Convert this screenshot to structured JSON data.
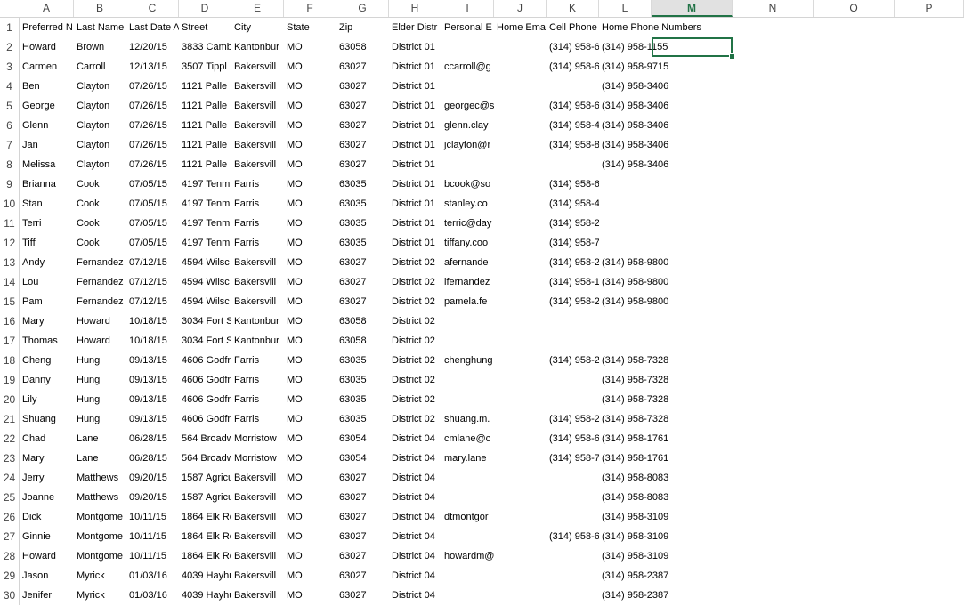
{
  "sheet": {
    "columns": [
      "A",
      "B",
      "C",
      "D",
      "E",
      "F",
      "G",
      "H",
      "I",
      "J",
      "K",
      "L",
      "M",
      "N",
      "O",
      "P"
    ],
    "active_column": "M",
    "row_numbers": [
      "1",
      "2",
      "3",
      "4",
      "5",
      "6",
      "7",
      "8",
      "9",
      "10",
      "11",
      "12",
      "13",
      "14",
      "15",
      "16",
      "17",
      "18",
      "19",
      "20",
      "21",
      "22",
      "23",
      "24",
      "25",
      "26",
      "27",
      "28",
      "29",
      "30"
    ],
    "headers": [
      "Preferred N",
      "Last Name",
      "Last Date A",
      "Street",
      "City",
      "State",
      "Zip",
      "Elder Distr",
      "Personal E",
      "Home Ema",
      "Cell Phone",
      "Home Phone Numbers"
    ],
    "rows": [
      [
        "Howard",
        "Brown",
        "12/20/15",
        "3833 Camb",
        "Kantonbur",
        "MO",
        "63058",
        "District 01",
        "",
        "",
        "(314) 958-6",
        "(314) 958-1155"
      ],
      [
        "Carmen",
        "Carroll",
        "12/13/15",
        "3507 Tippl",
        "Bakersvill",
        "MO",
        "63027",
        "District 01",
        "ccarroll@g",
        "",
        "(314) 958-6",
        "(314) 958-9715"
      ],
      [
        "Ben",
        "Clayton",
        "07/26/15",
        "1121 Palle",
        "Bakersvill",
        "MO",
        "63027",
        "District 01",
        "",
        "",
        "",
        "(314) 958-3406"
      ],
      [
        "George",
        "Clayton",
        "07/26/15",
        "1121 Palle",
        "Bakersvill",
        "MO",
        "63027",
        "District 01",
        "georgec@s",
        "",
        "(314) 958-6",
        "(314) 958-3406"
      ],
      [
        "Glenn",
        "Clayton",
        "07/26/15",
        "1121 Palle",
        "Bakersvill",
        "MO",
        "63027",
        "District 01",
        "glenn.clay",
        "",
        "(314) 958-4",
        "(314) 958-3406"
      ],
      [
        "Jan",
        "Clayton",
        "07/26/15",
        "1121 Palle",
        "Bakersvill",
        "MO",
        "63027",
        "District 01",
        "jclayton@r",
        "",
        "(314) 958-8",
        "(314) 958-3406"
      ],
      [
        "Melissa",
        "Clayton",
        "07/26/15",
        "1121 Palle",
        "Bakersvill",
        "MO",
        "63027",
        "District 01",
        "",
        "",
        "",
        "(314) 958-3406"
      ],
      [
        "Brianna",
        "Cook",
        "07/05/15",
        "4197 Tenm",
        "Farris",
        "MO",
        "63035",
        "District 01",
        "bcook@so",
        "",
        "(314) 958-6",
        ""
      ],
      [
        "Stan",
        "Cook",
        "07/05/15",
        "4197 Tenm",
        "Farris",
        "MO",
        "63035",
        "District 01",
        "stanley.co",
        "",
        "(314) 958-4",
        ""
      ],
      [
        "Terri",
        "Cook",
        "07/05/15",
        "4197 Tenm",
        "Farris",
        "MO",
        "63035",
        "District 01",
        "terric@day",
        "",
        "(314) 958-2",
        ""
      ],
      [
        "Tiff",
        "Cook",
        "07/05/15",
        "4197 Tenm",
        "Farris",
        "MO",
        "63035",
        "District 01",
        "tiffany.coo",
        "",
        "(314) 958-7",
        ""
      ],
      [
        "Andy",
        "Fernandez",
        "07/12/15",
        "4594 Wilsc",
        "Bakersvill",
        "MO",
        "63027",
        "District 02",
        "afernande",
        "",
        "(314) 958-2",
        "(314) 958-9800"
      ],
      [
        "Lou",
        "Fernandez",
        "07/12/15",
        "4594 Wilsc",
        "Bakersvill",
        "MO",
        "63027",
        "District 02",
        "lfernandez",
        "",
        "(314) 958-1",
        "(314) 958-9800"
      ],
      [
        "Pam",
        "Fernandez",
        "07/12/15",
        "4594 Wilsc",
        "Bakersvill",
        "MO",
        "63027",
        "District 02",
        "pamela.fe",
        "",
        "(314) 958-2",
        "(314) 958-9800"
      ],
      [
        "Mary",
        "Howard",
        "10/18/15",
        "3034 Fort S",
        "Kantonbur",
        "MO",
        "63058",
        "District 02",
        "",
        "",
        "",
        ""
      ],
      [
        "Thomas",
        "Howard",
        "10/18/15",
        "3034 Fort S",
        "Kantonbur",
        "MO",
        "63058",
        "District 02",
        "",
        "",
        "",
        ""
      ],
      [
        "Cheng",
        "Hung",
        "09/13/15",
        "4606 Godfr",
        "Farris",
        "MO",
        "63035",
        "District 02",
        "chenghung",
        "",
        "(314) 958-2",
        "(314) 958-7328"
      ],
      [
        "Danny",
        "Hung",
        "09/13/15",
        "4606 Godfr",
        "Farris",
        "MO",
        "63035",
        "District 02",
        "",
        "",
        "",
        "(314) 958-7328"
      ],
      [
        "Lily",
        "Hung",
        "09/13/15",
        "4606 Godfr",
        "Farris",
        "MO",
        "63035",
        "District 02",
        "",
        "",
        "",
        "(314) 958-7328"
      ],
      [
        "Shuang",
        "Hung",
        "09/13/15",
        "4606 Godfr",
        "Farris",
        "MO",
        "63035",
        "District 02",
        "shuang.m.",
        "",
        "(314) 958-2",
        "(314) 958-7328"
      ],
      [
        "Chad",
        "Lane",
        "06/28/15",
        "564 Broadw",
        "Morristow",
        "MO",
        "63054",
        "District 04",
        "cmlane@c",
        "",
        "(314) 958-6",
        "(314) 958-1761"
      ],
      [
        "Mary",
        "Lane",
        "06/28/15",
        "564 Broadw",
        "Morristow",
        "MO",
        "63054",
        "District 04",
        "mary.lane",
        "",
        "(314) 958-7",
        "(314) 958-1761"
      ],
      [
        "Jerry",
        "Matthews",
        "09/20/15",
        "1587 Agricu",
        "Bakersvill",
        "MO",
        "63027",
        "District 04",
        "",
        "",
        "",
        "(314) 958-8083"
      ],
      [
        "Joanne",
        "Matthews",
        "09/20/15",
        "1587 Agricu",
        "Bakersvill",
        "MO",
        "63027",
        "District 04",
        "",
        "",
        "",
        "(314) 958-8083"
      ],
      [
        "Dick",
        "Montgome",
        "10/11/15",
        "1864 Elk Ro",
        "Bakersvill",
        "MO",
        "63027",
        "District 04",
        "dtmontgor",
        "",
        "",
        "(314) 958-3109"
      ],
      [
        "Ginnie",
        "Montgome",
        "10/11/15",
        "1864 Elk Ro",
        "Bakersvill",
        "MO",
        "63027",
        "District 04",
        "",
        "",
        "(314) 958-6",
        "(314) 958-3109"
      ],
      [
        "Howard",
        "Montgome",
        "10/11/15",
        "1864 Elk Ro",
        "Bakersvill",
        "MO",
        "63027",
        "District 04",
        "howardm@",
        "",
        "",
        "(314) 958-3109"
      ],
      [
        "Jason",
        "Myrick",
        "01/03/16",
        "4039 Hayhu",
        "Bakersvill",
        "MO",
        "63027",
        "District 04",
        "",
        "",
        "",
        "(314) 958-2387"
      ],
      [
        "Jenifer",
        "Myrick",
        "01/03/16",
        "4039 Hayhu",
        "Bakersvill",
        "MO",
        "63027",
        "District 04",
        "",
        "",
        "",
        "(314) 958-2387"
      ]
    ]
  }
}
